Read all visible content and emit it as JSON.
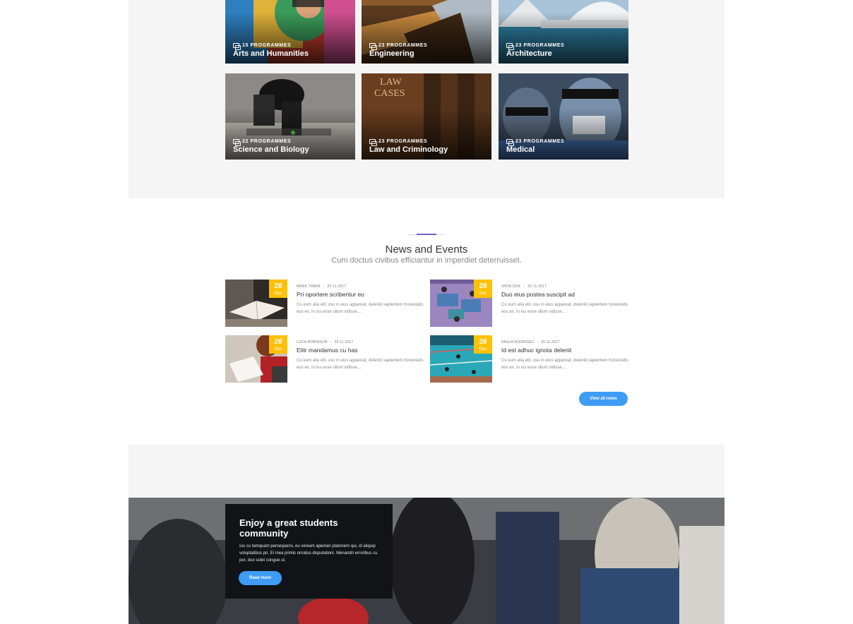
{
  "programmes": [
    {
      "count": "15 PROGRAMMES",
      "name": "Arts and Humanities"
    },
    {
      "count": "23 PROGRAMMES",
      "name": "Engineering"
    },
    {
      "count": "23 PROGRAMMES",
      "name": "Architecture"
    },
    {
      "count": "22 PROGRAMMES",
      "name": "Science and Biology"
    },
    {
      "count": "23 PROGRAMMES",
      "name": "Law and Criminology"
    },
    {
      "count": "23 PROGRAMMES",
      "name": "Medical"
    }
  ],
  "news": {
    "title": "News and Events",
    "subtitle": "Cum doctus civibus efficiantur in imperdiet deterruisset.",
    "items": [
      {
        "day": "28",
        "month": "Dec",
        "author": "MARK TWAIN",
        "date": "20.11.2017",
        "title": "Pri oportere scribentur eu",
        "excerpt": "Cu eum alia elit, usu in eius appareat, deleniti sapientem honestatis eos ex. In ius esse ullum vidisse...."
      },
      {
        "day": "28",
        "month": "Dec",
        "author": "JHON DOE",
        "date": "20.11.2017",
        "title": "Duo eius postea suscipit ad",
        "excerpt": "Cu eum alia elit, usu in eius appareat, deleniti sapientem honestatis eos ex. In ius esse ullum vidisse...."
      },
      {
        "day": "28",
        "month": "Dec",
        "author": "LUCA ROBINSON",
        "date": "20.11.2017",
        "title": "Elitr mandamus cu has",
        "excerpt": "Cu eum alia elit, usu in eius appareat, deleniti sapientem honestatis eos ex. In ius esse ullum vidisse...."
      },
      {
        "day": "28",
        "month": "Dec",
        "author": "PAULA RODRIGEZ",
        "date": "20.11.2017",
        "title": "Id est adhuc ignota delenit",
        "excerpt": "Cu eum alia elit, usu in eius appareat, deleniti sapientem honestatis eos ex. In ius esse ullum vidisse...."
      }
    ],
    "view_all_label": "View all news"
  },
  "community": {
    "title": "Enjoy a great students community",
    "text": "Ius cu tamquam persequeris, eu veniam apeirian platonem qui, id aliquip voluptatibus pri. Ei mea primis ornatus disputationi. Menandri erroribus cu per, duo solet congue ut.",
    "button_label": "Read more"
  },
  "colors": {
    "accent": "#3f9cf5",
    "date_badge": "#ffc107",
    "divider_accent": "#6c63c7",
    "dark_box": "#121317"
  }
}
